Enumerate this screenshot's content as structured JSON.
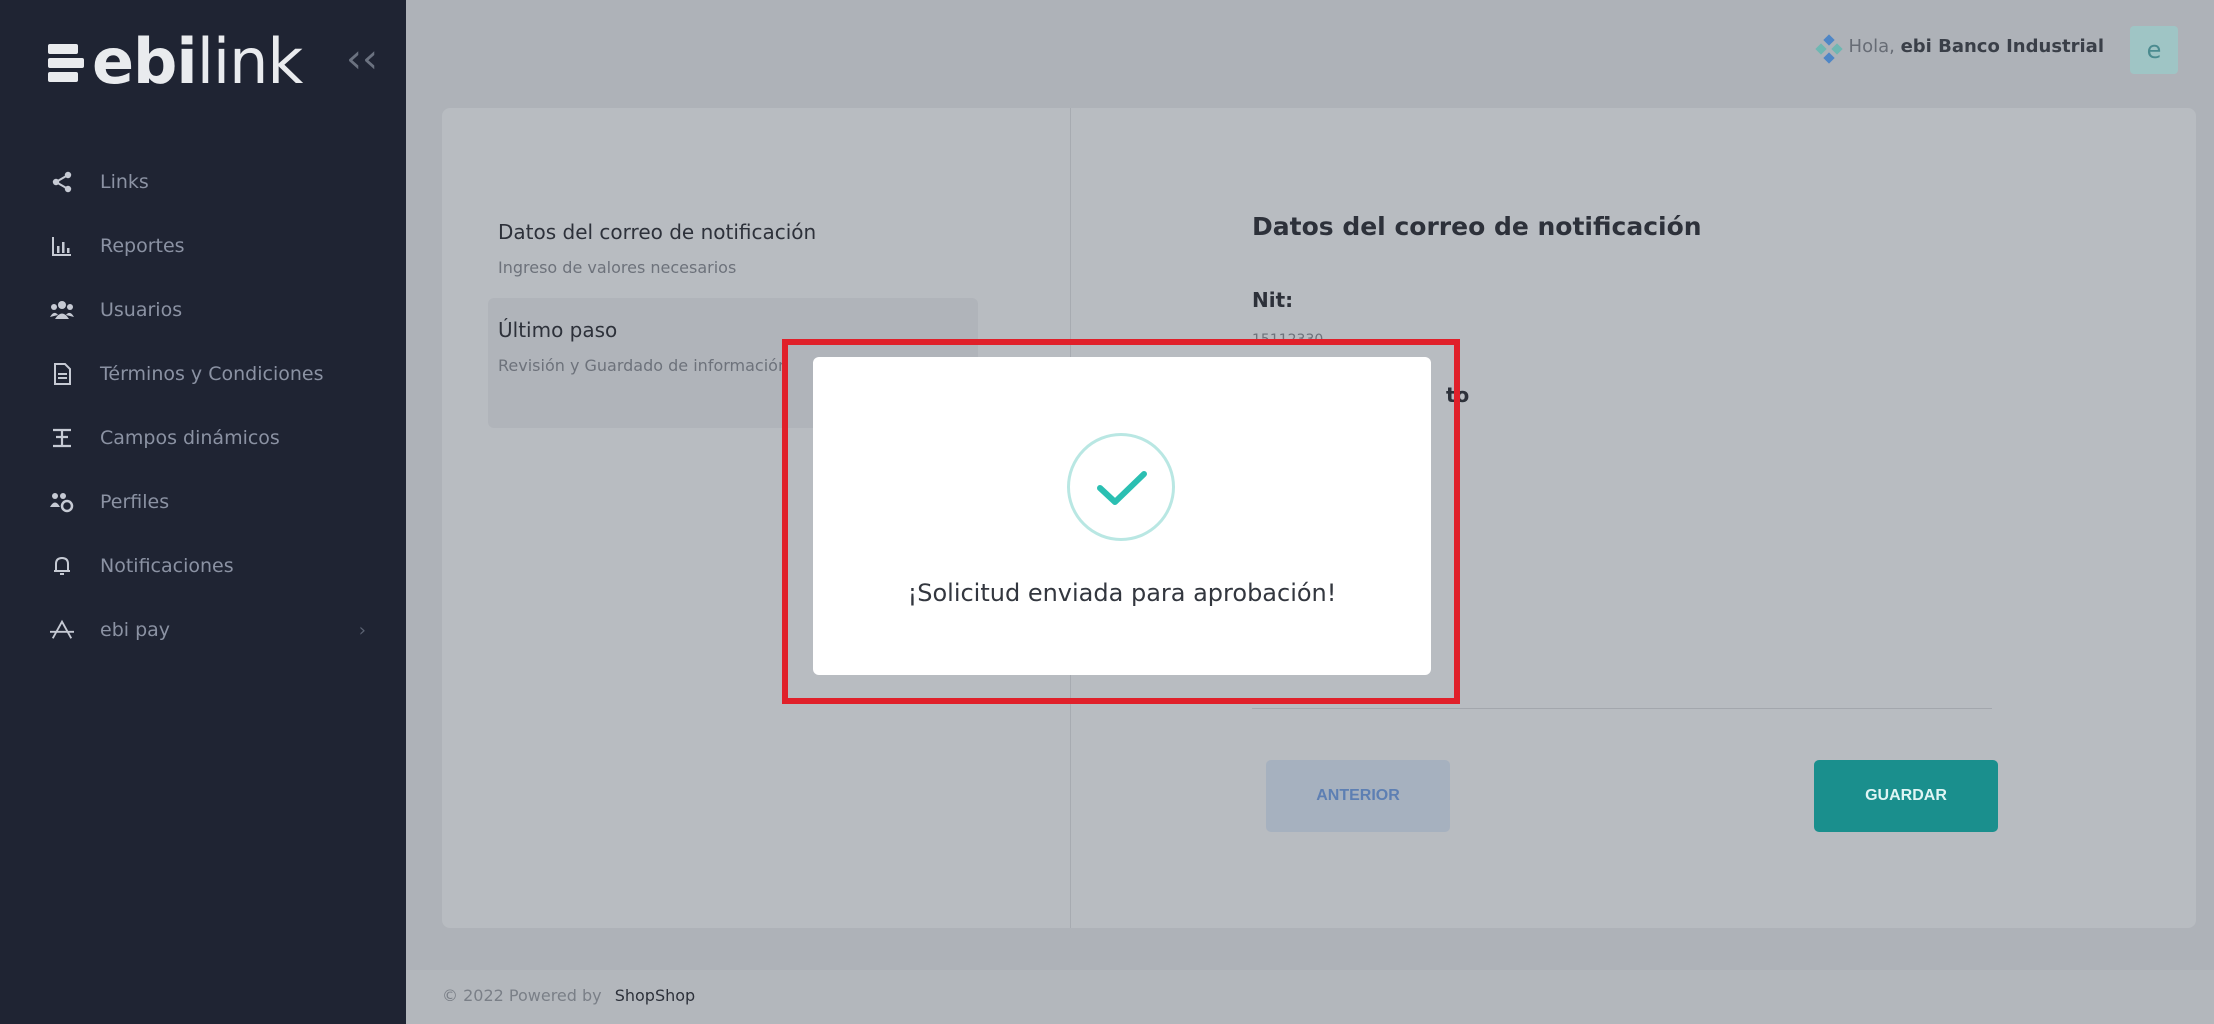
{
  "brand": {
    "name_bold": "ebi",
    "name_thin": "link",
    "collapse_glyph": "‹‹"
  },
  "sidebar": {
    "items": [
      {
        "label": "Links",
        "icon": "share-icon"
      },
      {
        "label": "Reportes",
        "icon": "bar-chart-icon"
      },
      {
        "label": "Usuarios",
        "icon": "users-icon"
      },
      {
        "label": "Términos y Condiciones",
        "icon": "document-icon"
      },
      {
        "label": "Campos dinámicos",
        "icon": "fields-icon"
      },
      {
        "label": "Perfiles",
        "icon": "profiles-icon"
      },
      {
        "label": "Notificaciones",
        "icon": "bell-icon"
      },
      {
        "label": "ebi pay",
        "icon": "pay-icon",
        "has_submenu": true
      }
    ]
  },
  "topbar": {
    "greeting": "Hola,",
    "user_name": "ebi Banco Industrial",
    "avatar_letter": "e"
  },
  "steps": [
    {
      "title": "Datos del correo de notificación",
      "subtitle": "Ingreso de valores necesarios"
    },
    {
      "title": "Último paso",
      "subtitle": "Revisión y Guardado de información",
      "active": true
    }
  ],
  "content": {
    "title": "Datos del correo de notificación",
    "field_label": "Nit:",
    "field_value": "15112330",
    "partial_label": "to"
  },
  "buttons": {
    "prev": "ANTERIOR",
    "save": "GUARDAR"
  },
  "footer": {
    "text": "© 2022 Powered by",
    "brand": "ShopShop"
  },
  "modal": {
    "message": "¡Solicitud enviada para aprobación!"
  },
  "colors": {
    "sidebar_bg": "#1f2433",
    "accent_teal": "#1a8f8d",
    "check_color": "#2bbfb2",
    "highlight_red": "#e0202a"
  }
}
